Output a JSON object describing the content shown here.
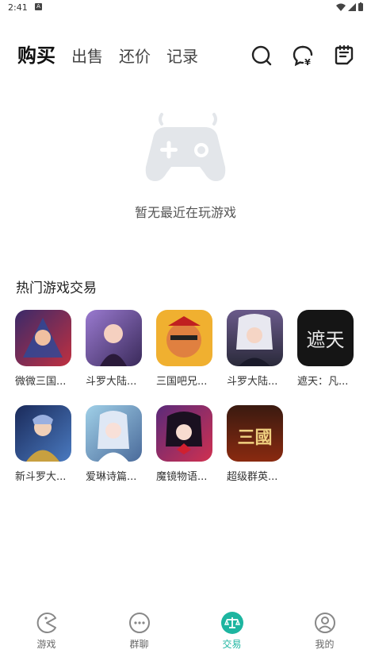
{
  "status_bar": {
    "time": "2:41"
  },
  "header": {
    "tabs": [
      {
        "label": "购买",
        "active": true
      },
      {
        "label": "出售",
        "active": false
      },
      {
        "label": "还价",
        "active": false
      },
      {
        "label": "记录",
        "active": false
      }
    ],
    "actions": [
      "search-icon",
      "chat-price-icon",
      "notes-icon"
    ]
  },
  "empty_state": {
    "message": "暂无最近在玩游戏",
    "icon": "gamepad-icon"
  },
  "hot_section": {
    "title": "热门游戏交易",
    "games": [
      {
        "name": "微微三国...",
        "color": "#7a3a8a"
      },
      {
        "name": "斗罗大陆...",
        "color": "#6b56b0"
      },
      {
        "name": "三国吧兄...",
        "color": "#e8a020"
      },
      {
        "name": "斗罗大陆...",
        "color": "#5a4a7a"
      },
      {
        "name": "遮天：凡...",
        "color": "#1a1a1a",
        "logo_text": "遮天"
      },
      {
        "name": "新斗罗大...",
        "color": "#2a4a8a"
      },
      {
        "name": "爱琳诗篇...",
        "color": "#6aa8c8"
      },
      {
        "name": "魔镜物语...",
        "color": "#8a2040"
      },
      {
        "name": "超级群英...",
        "color": "#a02a1a",
        "logo_text": "三國"
      }
    ]
  },
  "bottom_nav": {
    "items": [
      {
        "label": "游戏",
        "icon": "pacman-icon",
        "active": false
      },
      {
        "label": "群聊",
        "icon": "chat-dots-icon",
        "active": false
      },
      {
        "label": "交易",
        "icon": "scale-icon",
        "active": true
      },
      {
        "label": "我的",
        "icon": "profile-icon",
        "active": false
      }
    ],
    "accent": "#1db5a0"
  }
}
